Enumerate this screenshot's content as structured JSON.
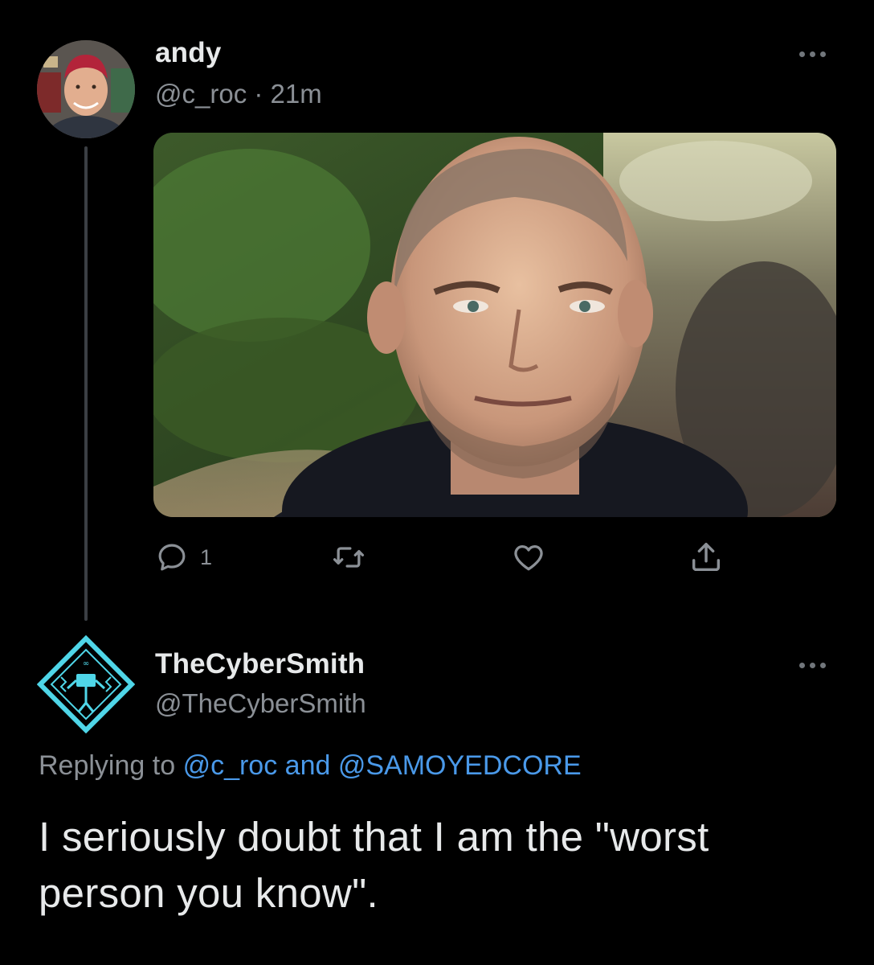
{
  "tweet1": {
    "display_name": "andy",
    "handle": "@c_roc",
    "separator": " · ",
    "time": "21m",
    "more_icon": "more-horizontal-icon",
    "media_icon": "photo",
    "actions": {
      "reply_icon": "reply-icon",
      "reply_count": "1",
      "retweet_icon": "retweet-icon",
      "like_icon": "heart-icon",
      "share_icon": "share-icon"
    }
  },
  "tweet2": {
    "display_name": "TheCyberSmith",
    "handle": "@TheCyberSmith",
    "more_icon": "more-horizontal-icon",
    "replying_prefix": "Replying to",
    "mention1": "@c_roc",
    "connector": "and",
    "mention2": "@SAMOYEDCORE",
    "text": "I seriously doubt that I am the \"worst person you know\"."
  },
  "colors": {
    "background": "#000000",
    "text_primary": "#e7e9ea",
    "text_secondary": "#8b9096",
    "mention_blue": "#4a99e9",
    "avatar_cyan": "#4fd6e8"
  }
}
